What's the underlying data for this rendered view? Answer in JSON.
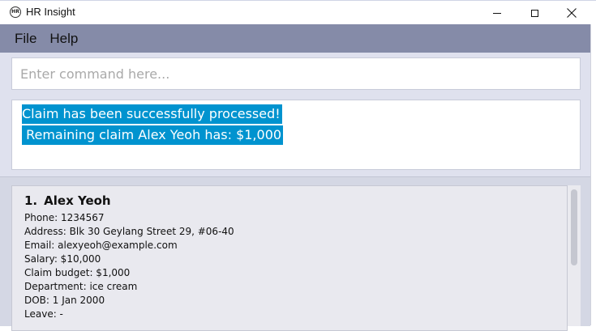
{
  "window": {
    "icon_text": "HR",
    "title": "HR Insight",
    "icons": {
      "minimize": "minimize-icon",
      "maximize": "maximize-icon",
      "close": "close-icon"
    }
  },
  "menu": {
    "items": [
      {
        "label": "File"
      },
      {
        "label": "Help"
      }
    ]
  },
  "command": {
    "placeholder": "Enter command here...",
    "value": ""
  },
  "result": {
    "lines": [
      "Claim has been successfully processed!",
      " Remaining claim Alex Yeoh has: $1,000"
    ],
    "highlight_color": "#0093cf"
  },
  "employees": [
    {
      "index": "1.",
      "name": "Alex Yeoh",
      "phone": "Phone: 1234567",
      "address": "Address: Blk 30 Geylang Street 29, #06-40",
      "email": "Email: alexyeoh@example.com",
      "salary": "Salary: $10,000",
      "claim_budget": "Claim budget: $1,000",
      "department": "Department: ice cream",
      "dob": "DOB: 1 Jan 2000",
      "leave": "Leave: -"
    }
  ],
  "colors": {
    "menubar": "#858ba8",
    "background": "#dfe1ee",
    "card": "#e9e9ef"
  }
}
